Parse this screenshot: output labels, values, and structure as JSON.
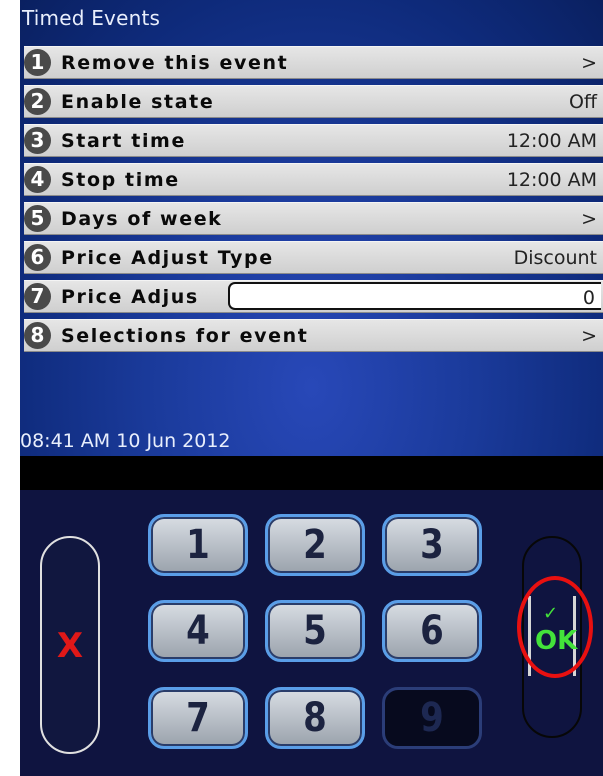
{
  "header": {
    "title": "Timed Events"
  },
  "rows": [
    {
      "num": "1",
      "label": "Remove this event",
      "value": ">"
    },
    {
      "num": "2",
      "label": "Enable state",
      "value": "Off"
    },
    {
      "num": "3",
      "label": "Start time",
      "value": "12:00 AM"
    },
    {
      "num": "4",
      "label": "Stop time",
      "value": "12:00 AM"
    },
    {
      "num": "5",
      "label": "Days of week",
      "value": ">"
    },
    {
      "num": "6",
      "label": "Price Adjust Type",
      "value": "Discount"
    },
    {
      "num": "7",
      "label": "Price Adjus",
      "value": "0"
    },
    {
      "num": "8",
      "label": "Selections for event",
      "value": ">"
    }
  ],
  "status": {
    "clock": "08:41 AM 10 Jun 2012"
  },
  "keypad": {
    "keys": [
      "1",
      "2",
      "3",
      "4",
      "5",
      "6",
      "7",
      "8",
      "9"
    ],
    "cancel_label": "X",
    "ok_label": "OK",
    "ok_check": "✓"
  },
  "colors": {
    "background_top": "#1a3a9a",
    "row_bg": "#d8d8d8",
    "keypad_bg": "#0f1440",
    "key_border": "#5a9ee8",
    "cancel_color": "#e01818",
    "ok_color": "#43e23a",
    "highlight_ring": "#e81010"
  }
}
